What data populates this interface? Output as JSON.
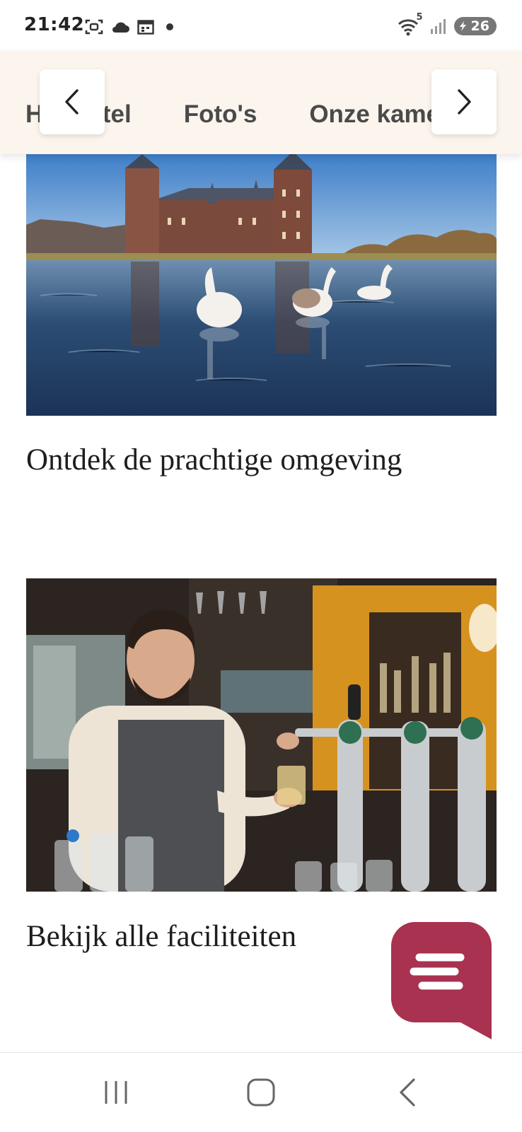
{
  "status_bar": {
    "time": "21:42",
    "left_icons": [
      "screenshot-icon",
      "cloud-icon",
      "calendar-icon",
      "dot-icon"
    ],
    "right_icons": [
      "wifi-icon",
      "signal-icon",
      "battery-icon"
    ],
    "wifi_label": "5",
    "battery_level": "26"
  },
  "tab_nav": {
    "tabs": [
      "Het hotel",
      "Foto's",
      "Onze kamers"
    ],
    "prev_icon": "chevron-left-icon",
    "next_icon": "chevron-right-icon"
  },
  "cards": [
    {
      "title": "Ontdek de prachtige omgeving",
      "image": "castle-lake-swans"
    },
    {
      "title": "Bekijk alle faciliteiten",
      "image": "bartender-beer-taps"
    }
  ],
  "chat_fab": {
    "icon": "chat-bubble-icon",
    "color": "#a8324f"
  },
  "system_nav": {
    "recents_icon": "recents-icon",
    "home_icon": "home-icon",
    "back_icon": "back-icon"
  }
}
